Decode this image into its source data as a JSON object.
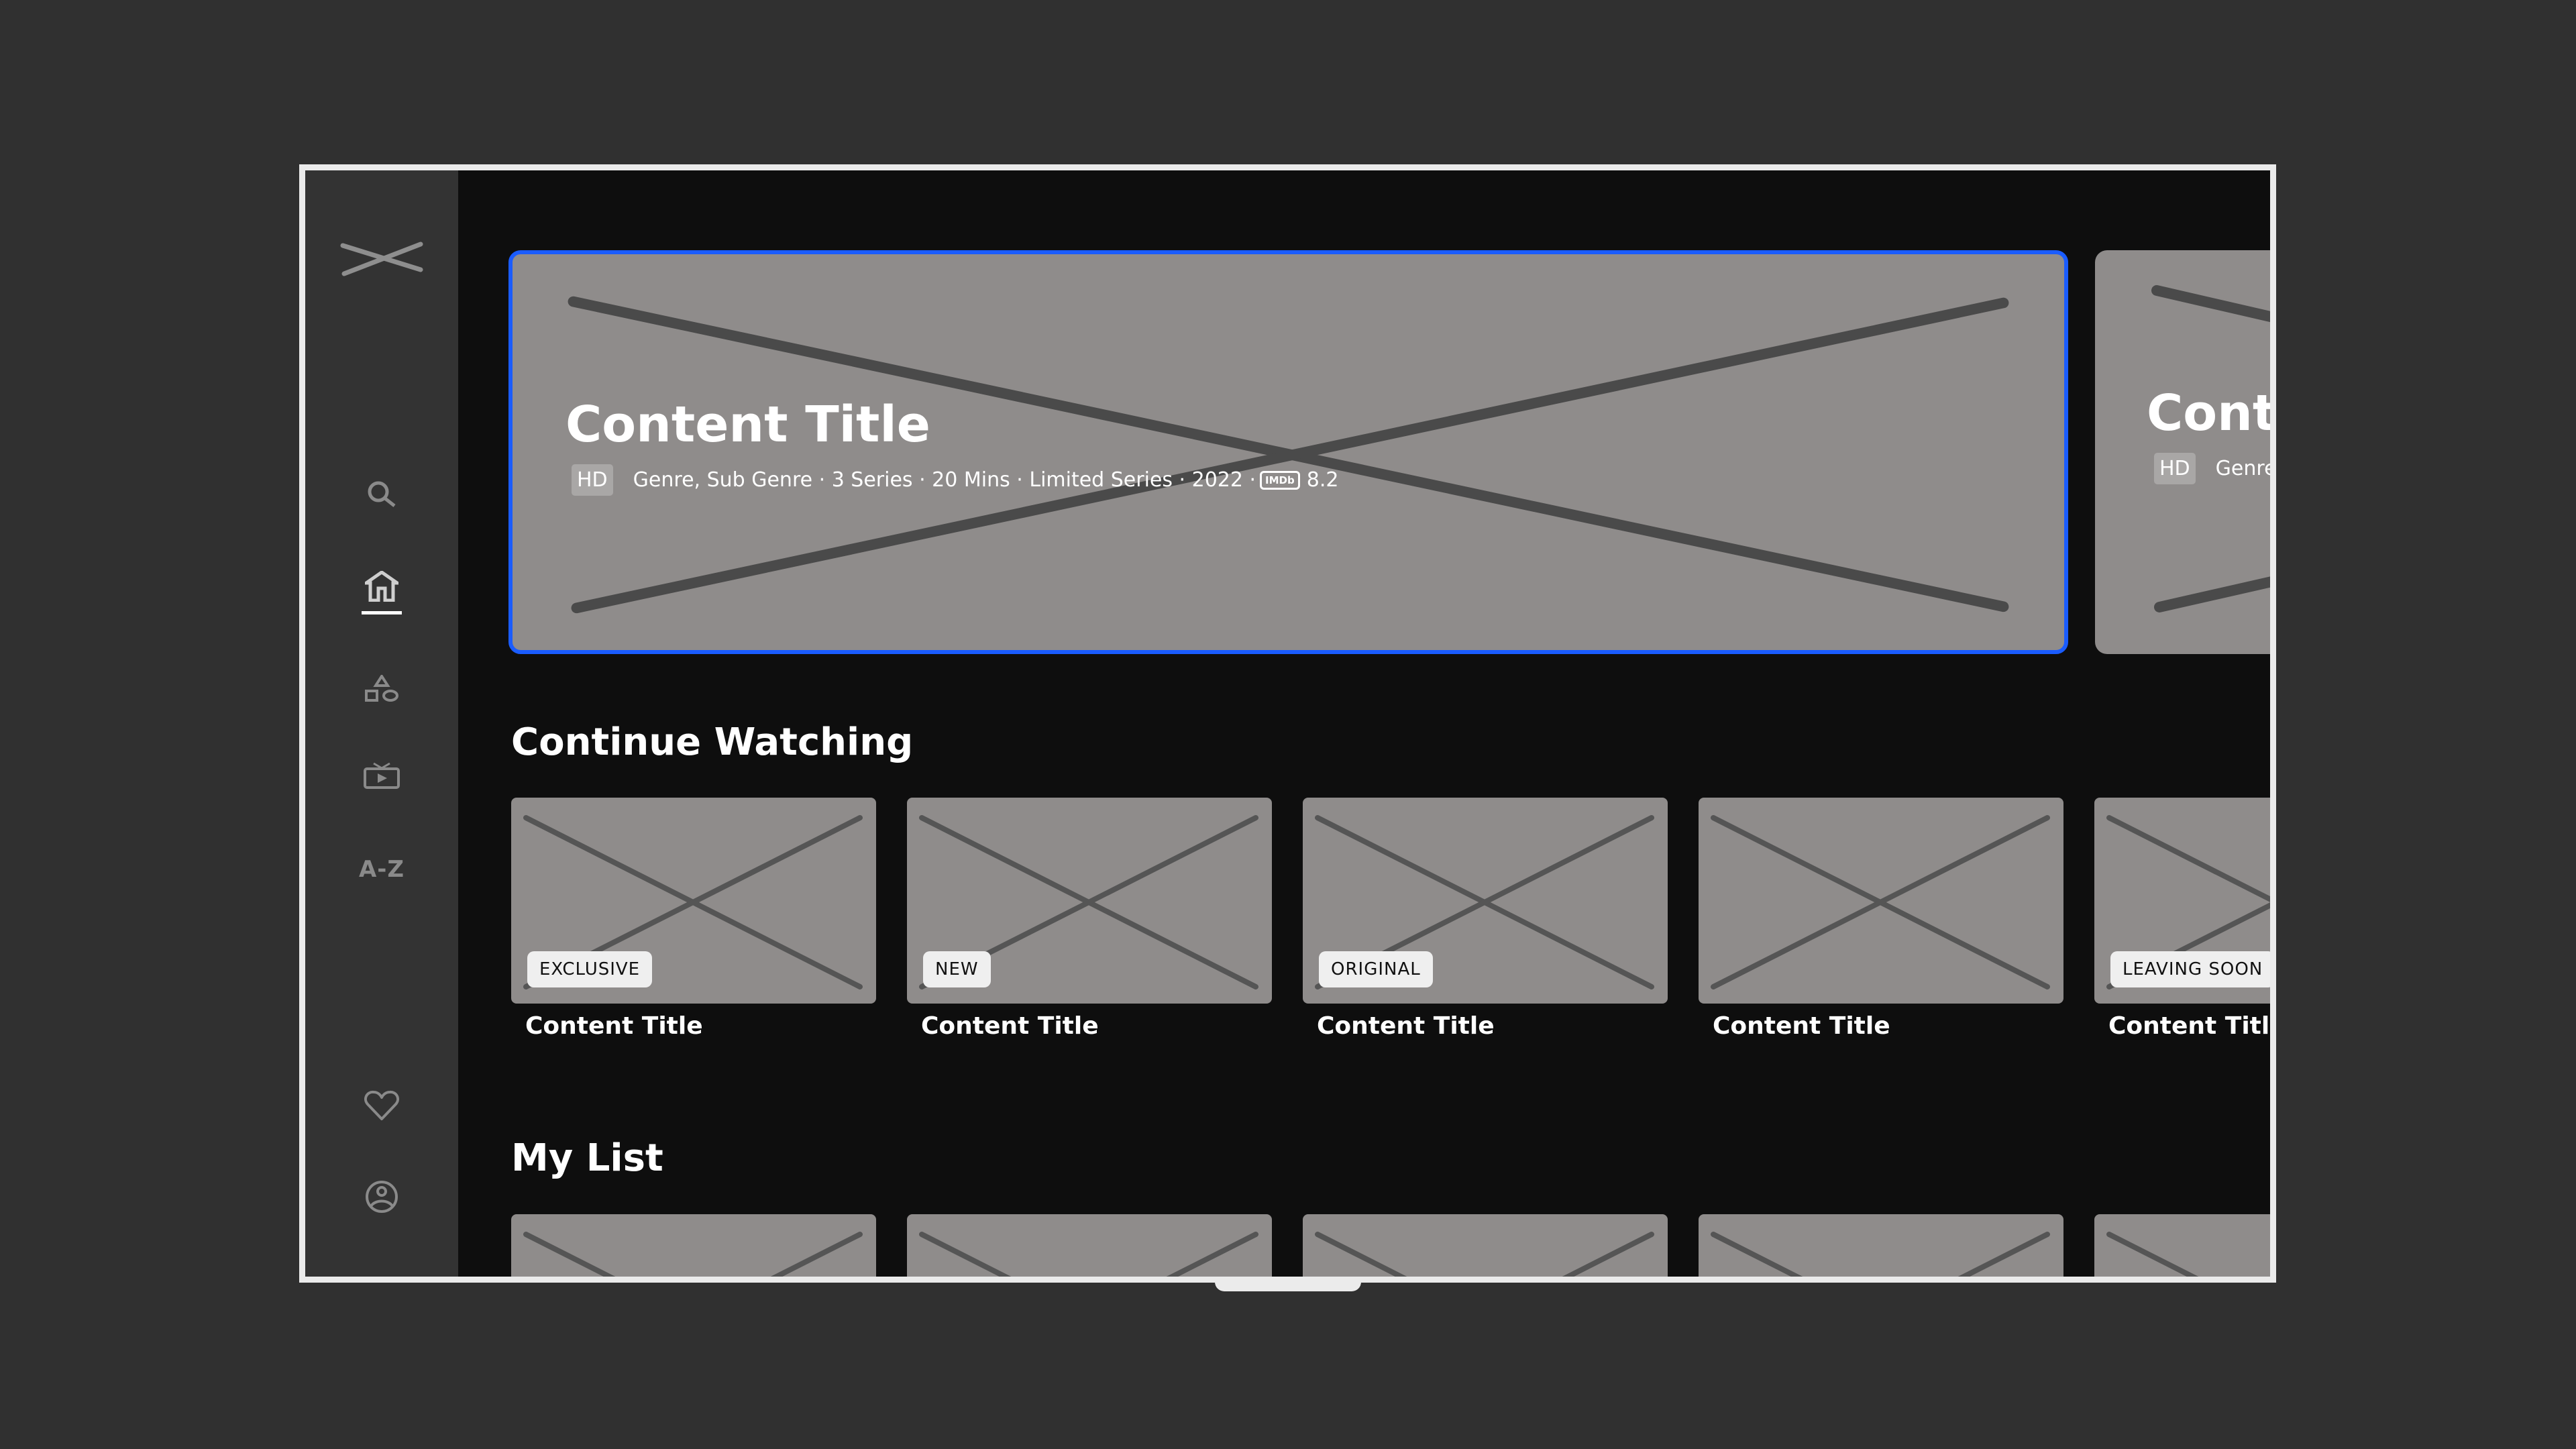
{
  "app": {
    "logo_icon": "x-logo-icon",
    "focus_color": "#1a5cff"
  },
  "sidebar": {
    "items": [
      {
        "id": "search",
        "icon": "search-icon",
        "active": false
      },
      {
        "id": "home",
        "icon": "home-icon",
        "active": true
      },
      {
        "id": "categories",
        "icon": "shapes-icon",
        "active": false
      },
      {
        "id": "live-tv",
        "icon": "tv-play-icon",
        "active": false
      },
      {
        "id": "a-z",
        "label": "A-Z",
        "active": false
      }
    ],
    "bottom_items": [
      {
        "id": "favourites",
        "icon": "heart-icon"
      },
      {
        "id": "profile",
        "icon": "profile-icon"
      }
    ]
  },
  "hero": {
    "items": [
      {
        "title": "Content Title",
        "quality": "HD",
        "meta": "Genre, Sub Genre · 3 Series · 20 Mins · Limited Series · 2022 ·",
        "imdb_label": "IMDb",
        "imdb_rating": "8.2",
        "focused": true
      },
      {
        "title": "Content Title",
        "quality": "HD",
        "meta": "Genre, Sub Genre",
        "focused": false
      }
    ]
  },
  "continue_watching": {
    "title": "Continue Watching",
    "cards": [
      {
        "title": "Content Title",
        "badge": "EXCLUSIVE"
      },
      {
        "title": "Content Title",
        "badge": "NEW"
      },
      {
        "title": "Content Title",
        "badge": "ORIGINAL"
      },
      {
        "title": "Content Title",
        "badge": ""
      },
      {
        "title": "Content Title",
        "badge": "LEAVING SOON"
      }
    ]
  },
  "my_list": {
    "title": "My List",
    "cards": [
      {},
      {},
      {},
      {},
      {}
    ]
  }
}
